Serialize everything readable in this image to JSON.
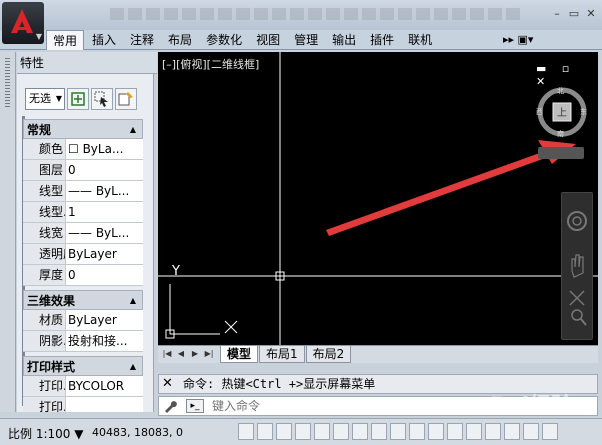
{
  "app": {
    "title": "",
    "menu_caret": "▼"
  },
  "window_controls": {
    "minimize": "–",
    "restore": "▭",
    "close": "✕"
  },
  "ribbon": {
    "tabs": [
      {
        "label": "常用",
        "active": true
      },
      {
        "label": "插入"
      },
      {
        "label": "注释"
      },
      {
        "label": "布局"
      },
      {
        "label": "参数化"
      },
      {
        "label": "视图"
      },
      {
        "label": "管理"
      },
      {
        "label": "输出"
      },
      {
        "label": "插件"
      },
      {
        "label": "联机"
      }
    ],
    "more": "▸▸ ▣▾"
  },
  "palette": {
    "title": "特性",
    "selection": "无选",
    "sections": [
      {
        "title": "常规",
        "rows": [
          {
            "name": "颜色",
            "value": "☐ ByLa..."
          },
          {
            "name": "图层",
            "value": "0"
          },
          {
            "name": "线型",
            "value": "—— ByL..."
          },
          {
            "name": "线型...",
            "value": "1"
          },
          {
            "name": "线宽",
            "value": "—— ByL..."
          },
          {
            "name": "透明度",
            "value": "ByLayer"
          },
          {
            "name": "厚度",
            "value": "0"
          }
        ]
      },
      {
        "title": "三维效果",
        "rows": [
          {
            "name": "材质",
            "value": "ByLayer"
          },
          {
            "name": "阴影...",
            "value": "投射和接..."
          }
        ]
      },
      {
        "title": "打印样式",
        "rows": [
          {
            "name": "打印...",
            "value": "BYCOLOR"
          },
          {
            "name": "打印...",
            "value": ""
          }
        ]
      }
    ]
  },
  "viewport": {
    "label": "[–][俯视][二维线框]",
    "controls": "▬ ▫ ✕",
    "viewcube": {
      "top": "上",
      "north": "北",
      "south": "南",
      "west": "西",
      "east": "东"
    },
    "ucs_y": "Y",
    "arrow_color": "#e23b3b"
  },
  "layout_tabs": [
    {
      "label": "模型",
      "active": true
    },
    {
      "label": "布局1"
    },
    {
      "label": "布局2"
    }
  ],
  "command": {
    "history": "命令: 热键<Ctrl +>显示屏幕菜单",
    "close": "✕",
    "placeholder": "键入命令",
    "prompt_icon": "▸_"
  },
  "status": {
    "scale": "比例 1:100 ▼",
    "coords": "40483, 18083, 0"
  },
  "watermark": "Bai经验"
}
